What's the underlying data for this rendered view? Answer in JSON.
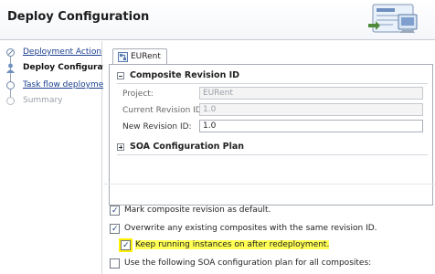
{
  "header": {
    "title": "Deploy Configuration"
  },
  "nav": {
    "items": [
      {
        "label": "Deployment Action",
        "state": "link"
      },
      {
        "label": "Deploy Configuration",
        "state": "current"
      },
      {
        "label": "Task flow deployment",
        "state": "link"
      },
      {
        "label": "Summary",
        "state": "disabled"
      }
    ]
  },
  "tab": {
    "label": "EURent"
  },
  "composite": {
    "heading": "Composite Revision ID",
    "project_label": "Project:",
    "project_value": "EURent",
    "current_label": "Current Revision ID:",
    "current_value": "1.0",
    "new_label": "New Revision ID:",
    "new_value": "1.0"
  },
  "soa": {
    "heading": "SOA Configuration Plan"
  },
  "options": [
    {
      "label": "Mark composite revision as default.",
      "checked": true,
      "highlight": false
    },
    {
      "label": "Overwrite any existing composites with the same revision ID.",
      "checked": true,
      "highlight": false
    },
    {
      "label": "Keep running instances on after redeployment.",
      "checked": true,
      "highlight": true
    },
    {
      "label": "Use the following SOA configuration plan for all composites:",
      "checked": false,
      "highlight": false
    }
  ],
  "colors": {
    "link": "#1a3f8f",
    "highlight": "#ffff54"
  }
}
